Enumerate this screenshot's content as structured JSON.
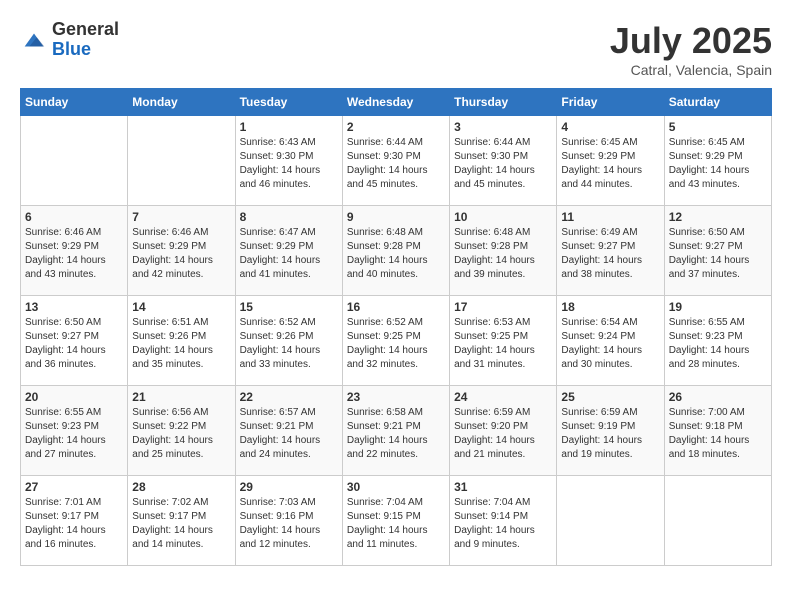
{
  "header": {
    "logo_general": "General",
    "logo_blue": "Blue",
    "month_title": "July 2025",
    "location": "Catral, Valencia, Spain"
  },
  "days_of_week": [
    "Sunday",
    "Monday",
    "Tuesday",
    "Wednesday",
    "Thursday",
    "Friday",
    "Saturday"
  ],
  "weeks": [
    [
      {
        "day": "",
        "sunrise": "",
        "sunset": "",
        "daylight": ""
      },
      {
        "day": "",
        "sunrise": "",
        "sunset": "",
        "daylight": ""
      },
      {
        "day": "1",
        "sunrise": "Sunrise: 6:43 AM",
        "sunset": "Sunset: 9:30 PM",
        "daylight": "Daylight: 14 hours and 46 minutes."
      },
      {
        "day": "2",
        "sunrise": "Sunrise: 6:44 AM",
        "sunset": "Sunset: 9:30 PM",
        "daylight": "Daylight: 14 hours and 45 minutes."
      },
      {
        "day": "3",
        "sunrise": "Sunrise: 6:44 AM",
        "sunset": "Sunset: 9:30 PM",
        "daylight": "Daylight: 14 hours and 45 minutes."
      },
      {
        "day": "4",
        "sunrise": "Sunrise: 6:45 AM",
        "sunset": "Sunset: 9:29 PM",
        "daylight": "Daylight: 14 hours and 44 minutes."
      },
      {
        "day": "5",
        "sunrise": "Sunrise: 6:45 AM",
        "sunset": "Sunset: 9:29 PM",
        "daylight": "Daylight: 14 hours and 43 minutes."
      }
    ],
    [
      {
        "day": "6",
        "sunrise": "Sunrise: 6:46 AM",
        "sunset": "Sunset: 9:29 PM",
        "daylight": "Daylight: 14 hours and 43 minutes."
      },
      {
        "day": "7",
        "sunrise": "Sunrise: 6:46 AM",
        "sunset": "Sunset: 9:29 PM",
        "daylight": "Daylight: 14 hours and 42 minutes."
      },
      {
        "day": "8",
        "sunrise": "Sunrise: 6:47 AM",
        "sunset": "Sunset: 9:29 PM",
        "daylight": "Daylight: 14 hours and 41 minutes."
      },
      {
        "day": "9",
        "sunrise": "Sunrise: 6:48 AM",
        "sunset": "Sunset: 9:28 PM",
        "daylight": "Daylight: 14 hours and 40 minutes."
      },
      {
        "day": "10",
        "sunrise": "Sunrise: 6:48 AM",
        "sunset": "Sunset: 9:28 PM",
        "daylight": "Daylight: 14 hours and 39 minutes."
      },
      {
        "day": "11",
        "sunrise": "Sunrise: 6:49 AM",
        "sunset": "Sunset: 9:27 PM",
        "daylight": "Daylight: 14 hours and 38 minutes."
      },
      {
        "day": "12",
        "sunrise": "Sunrise: 6:50 AM",
        "sunset": "Sunset: 9:27 PM",
        "daylight": "Daylight: 14 hours and 37 minutes."
      }
    ],
    [
      {
        "day": "13",
        "sunrise": "Sunrise: 6:50 AM",
        "sunset": "Sunset: 9:27 PM",
        "daylight": "Daylight: 14 hours and 36 minutes."
      },
      {
        "day": "14",
        "sunrise": "Sunrise: 6:51 AM",
        "sunset": "Sunset: 9:26 PM",
        "daylight": "Daylight: 14 hours and 35 minutes."
      },
      {
        "day": "15",
        "sunrise": "Sunrise: 6:52 AM",
        "sunset": "Sunset: 9:26 PM",
        "daylight": "Daylight: 14 hours and 33 minutes."
      },
      {
        "day": "16",
        "sunrise": "Sunrise: 6:52 AM",
        "sunset": "Sunset: 9:25 PM",
        "daylight": "Daylight: 14 hours and 32 minutes."
      },
      {
        "day": "17",
        "sunrise": "Sunrise: 6:53 AM",
        "sunset": "Sunset: 9:25 PM",
        "daylight": "Daylight: 14 hours and 31 minutes."
      },
      {
        "day": "18",
        "sunrise": "Sunrise: 6:54 AM",
        "sunset": "Sunset: 9:24 PM",
        "daylight": "Daylight: 14 hours and 30 minutes."
      },
      {
        "day": "19",
        "sunrise": "Sunrise: 6:55 AM",
        "sunset": "Sunset: 9:23 PM",
        "daylight": "Daylight: 14 hours and 28 minutes."
      }
    ],
    [
      {
        "day": "20",
        "sunrise": "Sunrise: 6:55 AM",
        "sunset": "Sunset: 9:23 PM",
        "daylight": "Daylight: 14 hours and 27 minutes."
      },
      {
        "day": "21",
        "sunrise": "Sunrise: 6:56 AM",
        "sunset": "Sunset: 9:22 PM",
        "daylight": "Daylight: 14 hours and 25 minutes."
      },
      {
        "day": "22",
        "sunrise": "Sunrise: 6:57 AM",
        "sunset": "Sunset: 9:21 PM",
        "daylight": "Daylight: 14 hours and 24 minutes."
      },
      {
        "day": "23",
        "sunrise": "Sunrise: 6:58 AM",
        "sunset": "Sunset: 9:21 PM",
        "daylight": "Daylight: 14 hours and 22 minutes."
      },
      {
        "day": "24",
        "sunrise": "Sunrise: 6:59 AM",
        "sunset": "Sunset: 9:20 PM",
        "daylight": "Daylight: 14 hours and 21 minutes."
      },
      {
        "day": "25",
        "sunrise": "Sunrise: 6:59 AM",
        "sunset": "Sunset: 9:19 PM",
        "daylight": "Daylight: 14 hours and 19 minutes."
      },
      {
        "day": "26",
        "sunrise": "Sunrise: 7:00 AM",
        "sunset": "Sunset: 9:18 PM",
        "daylight": "Daylight: 14 hours and 18 minutes."
      }
    ],
    [
      {
        "day": "27",
        "sunrise": "Sunrise: 7:01 AM",
        "sunset": "Sunset: 9:17 PM",
        "daylight": "Daylight: 14 hours and 16 minutes."
      },
      {
        "day": "28",
        "sunrise": "Sunrise: 7:02 AM",
        "sunset": "Sunset: 9:17 PM",
        "daylight": "Daylight: 14 hours and 14 minutes."
      },
      {
        "day": "29",
        "sunrise": "Sunrise: 7:03 AM",
        "sunset": "Sunset: 9:16 PM",
        "daylight": "Daylight: 14 hours and 12 minutes."
      },
      {
        "day": "30",
        "sunrise": "Sunrise: 7:04 AM",
        "sunset": "Sunset: 9:15 PM",
        "daylight": "Daylight: 14 hours and 11 minutes."
      },
      {
        "day": "31",
        "sunrise": "Sunrise: 7:04 AM",
        "sunset": "Sunset: 9:14 PM",
        "daylight": "Daylight: 14 hours and 9 minutes."
      },
      {
        "day": "",
        "sunrise": "",
        "sunset": "",
        "daylight": ""
      },
      {
        "day": "",
        "sunrise": "",
        "sunset": "",
        "daylight": ""
      }
    ]
  ]
}
